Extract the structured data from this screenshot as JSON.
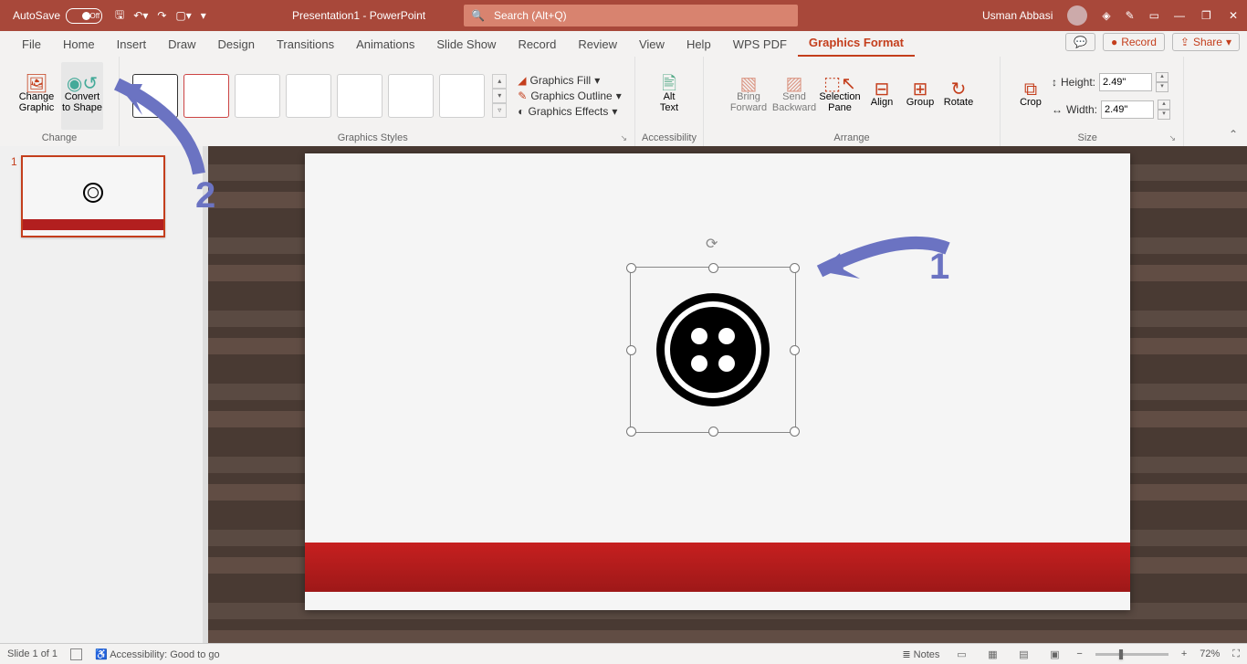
{
  "titlebar": {
    "autosave_label": "AutoSave",
    "autosave_state": "Off",
    "doc_title": "Presentation1  -  PowerPoint",
    "search_placeholder": "Search (Alt+Q)",
    "user_name": "Usman Abbasi"
  },
  "tabs": {
    "items": [
      "File",
      "Home",
      "Insert",
      "Draw",
      "Design",
      "Transitions",
      "Animations",
      "Slide Show",
      "Record",
      "Review",
      "View",
      "Help",
      "WPS PDF",
      "Graphics Format"
    ],
    "active": "Graphics Format",
    "record_btn": "Record",
    "share_btn": "Share"
  },
  "ribbon": {
    "change": {
      "change_graphic": "Change\nGraphic",
      "convert_to_shape": "Convert\nto Shape",
      "label": "Change"
    },
    "styles": {
      "label": "Graphics Styles",
      "fill": "Graphics Fill",
      "outline": "Graphics Outline",
      "effects": "Graphics Effects"
    },
    "accessibility": {
      "alt_text": "Alt\nText",
      "label": "Accessibility"
    },
    "arrange": {
      "bring_forward": "Bring\nForward",
      "send_backward": "Send\nBackward",
      "selection_pane": "Selection\nPane",
      "align": "Align",
      "group": "Group",
      "rotate": "Rotate",
      "label": "Arrange"
    },
    "size": {
      "crop": "Crop",
      "height_label": "Height:",
      "height_val": "2.49\"",
      "width_label": "Width:",
      "width_val": "2.49\"",
      "label": "Size"
    }
  },
  "thumbs": {
    "slide1_num": "1"
  },
  "annotations": {
    "one": "1",
    "two": "2"
  },
  "status": {
    "slide_info": "Slide 1 of 1",
    "accessibility": "Accessibility: Good to go",
    "notes": "Notes",
    "zoom": "72%"
  }
}
